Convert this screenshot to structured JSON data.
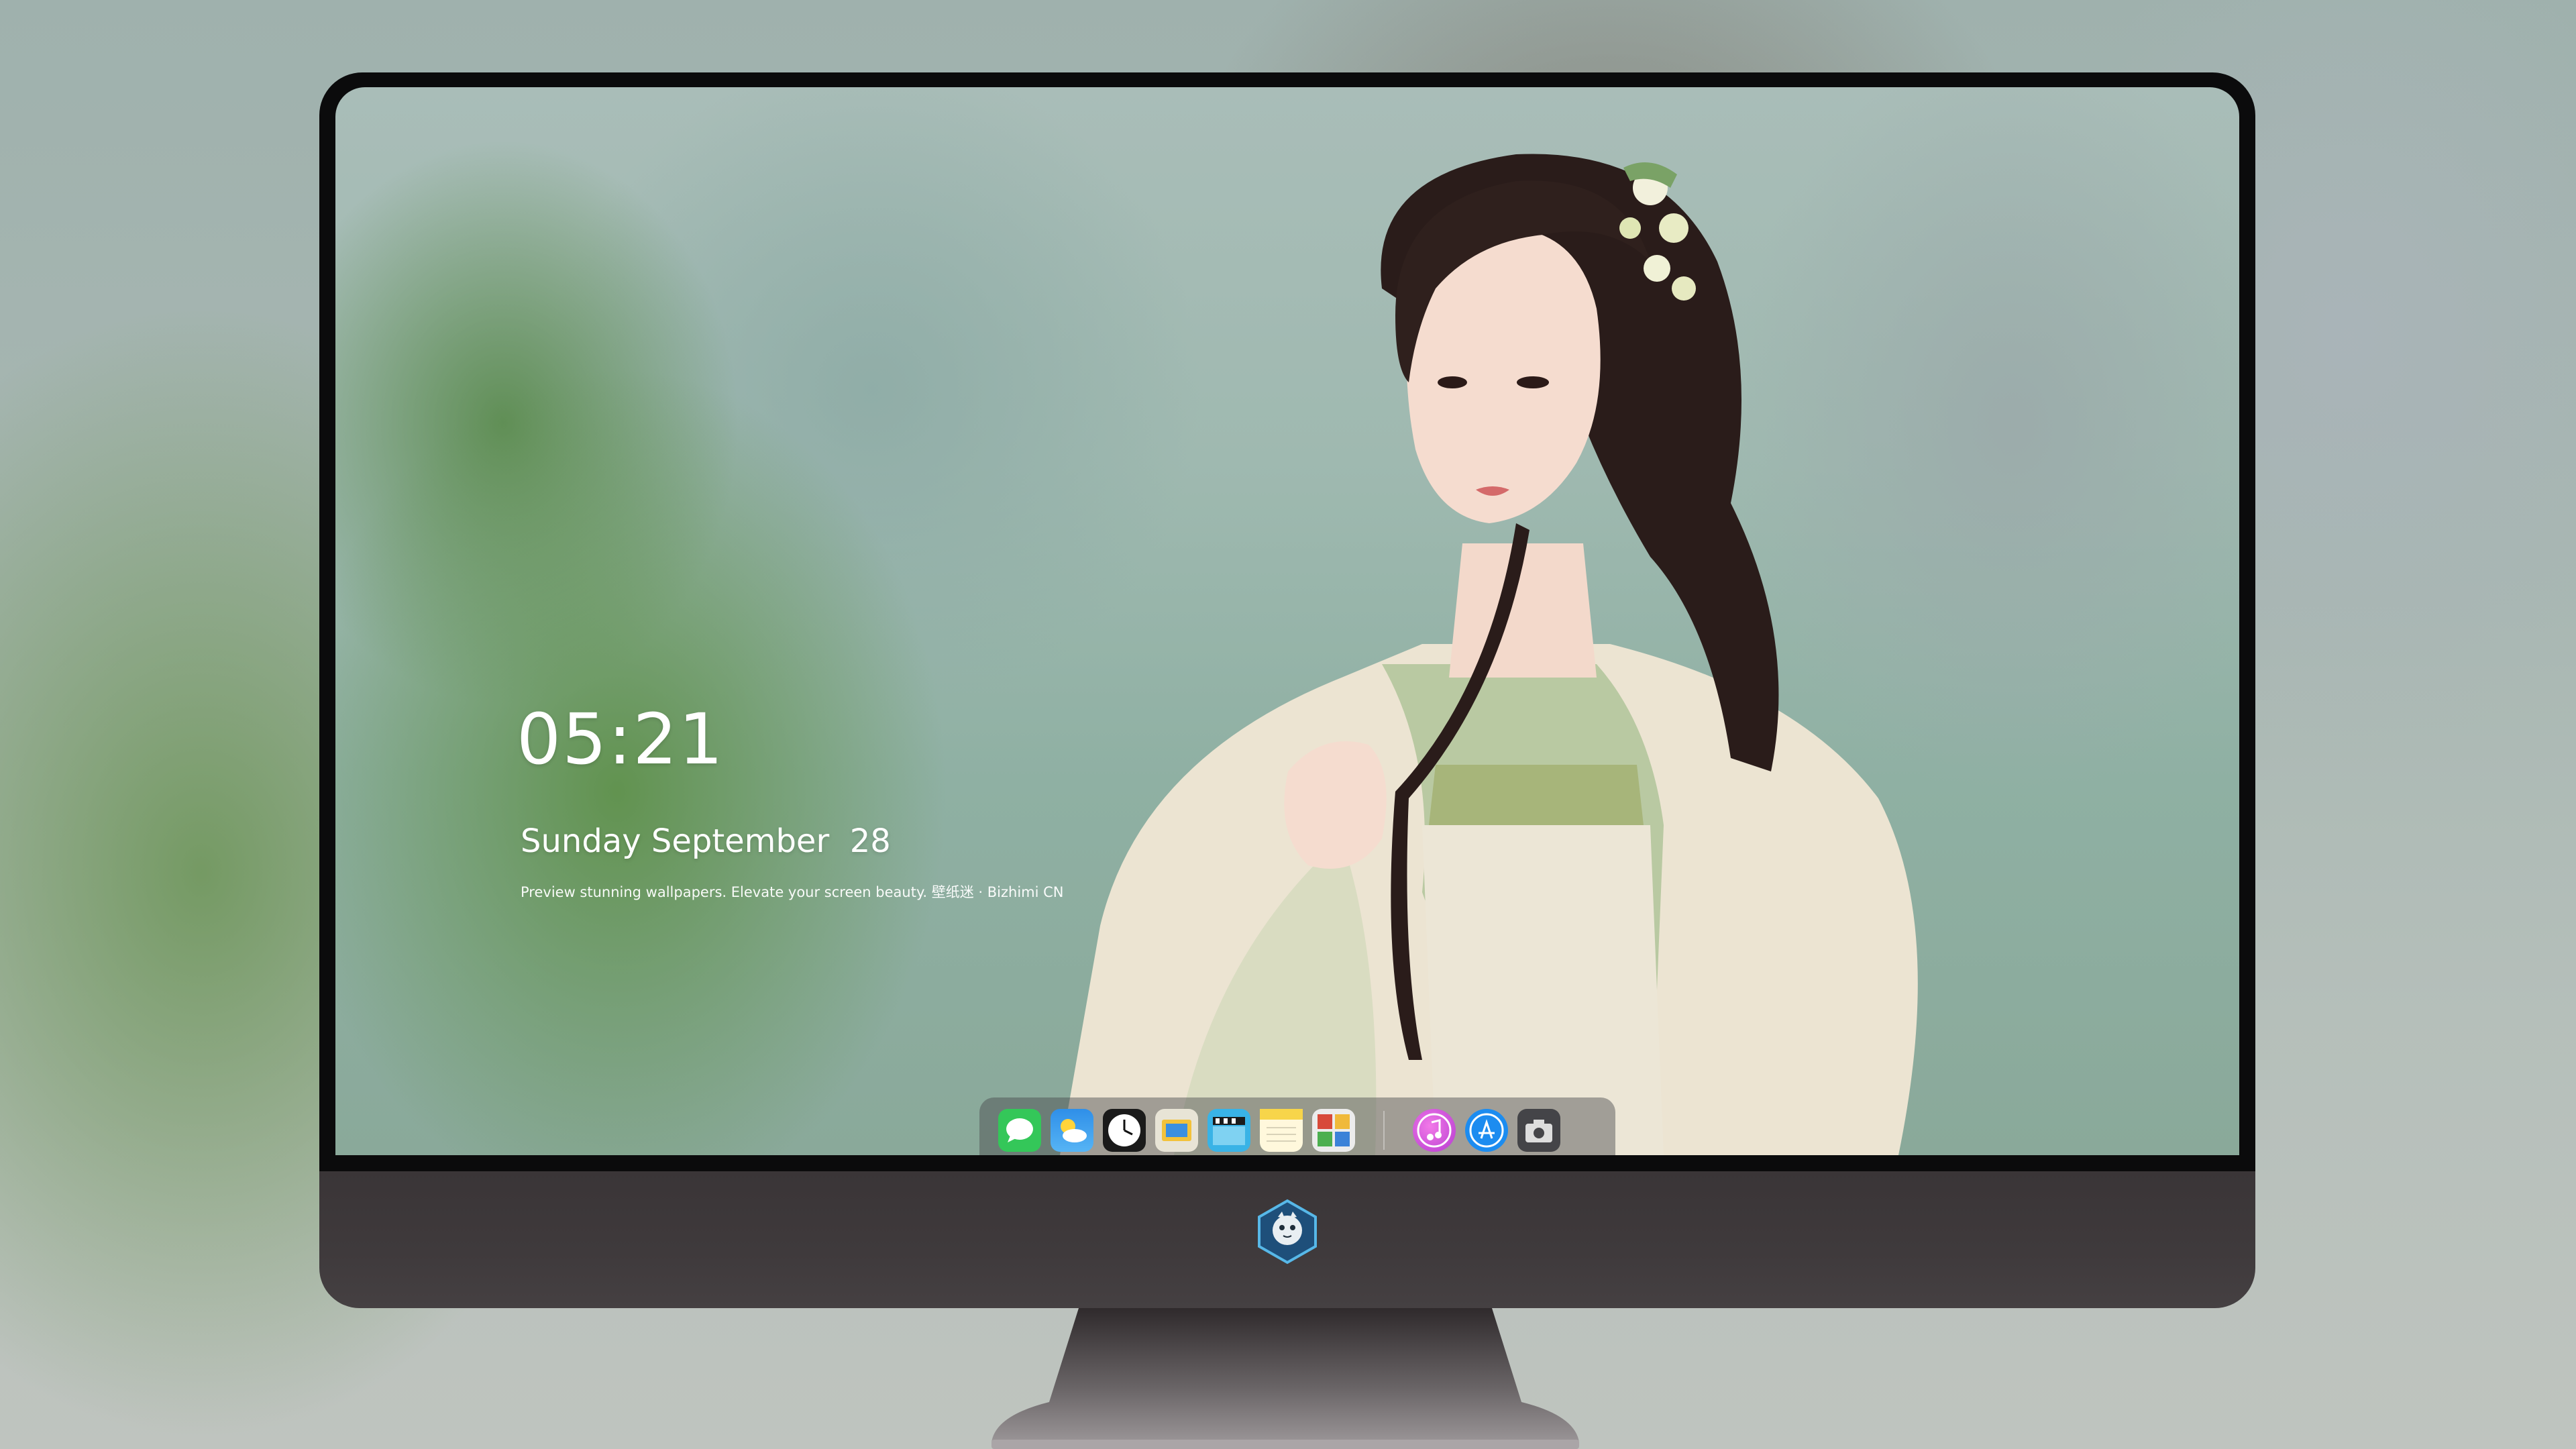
{
  "lockscreen": {
    "time": "05:21",
    "date": "Sunday September  28",
    "tagline": "Preview stunning wallpapers. Elevate your screen beauty. 壁纸迷 · Bizhimi CN"
  },
  "dock": {
    "apps": [
      {
        "name": "messages",
        "color": "#34c759"
      },
      {
        "name": "weather",
        "color": "#2f8fe8"
      },
      {
        "name": "clock",
        "color": "#1a1a1a"
      },
      {
        "name": "preview",
        "color": "#e9b93a"
      },
      {
        "name": "clips",
        "color": "#39b3e6"
      },
      {
        "name": "notes",
        "color": "#f7d54a"
      },
      {
        "name": "photo-booth",
        "color": "#d84a3a"
      },
      {
        "name": "music",
        "color": "#e04fd8"
      },
      {
        "name": "app-store",
        "color": "#1c8cf0"
      },
      {
        "name": "screenshot",
        "color": "#444448"
      }
    ]
  },
  "colors": {
    "bezel": "#0b0b0c",
    "chin": "#3f3a3c",
    "stand": "#8f8b8c"
  }
}
